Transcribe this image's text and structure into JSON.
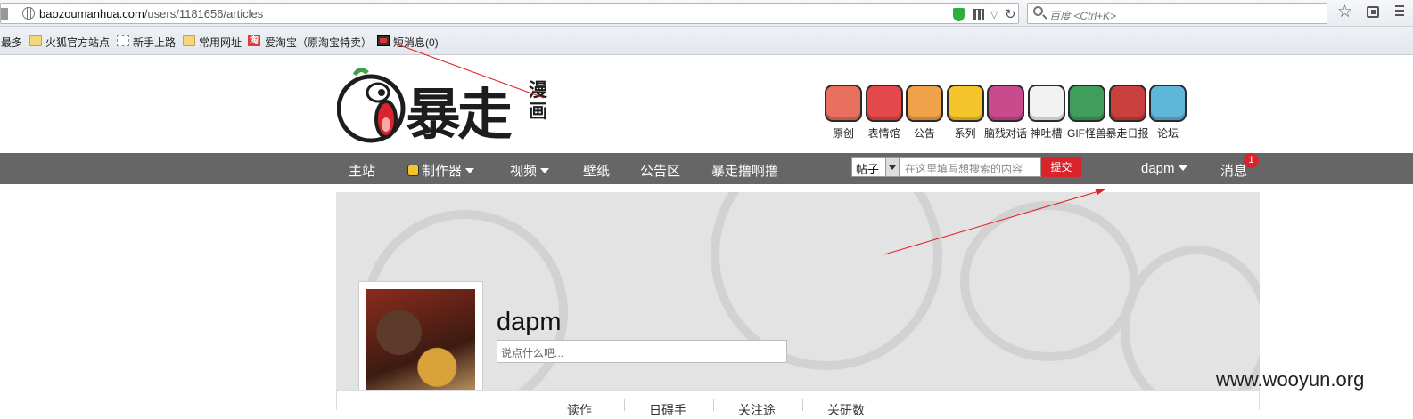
{
  "browser": {
    "url_domain": "baozoumanhua.com",
    "url_path": "/users/1181656/articles",
    "search_placeholder": "百度 <Ctrl+K>",
    "bookmarks": [
      "最多",
      "火狐官方站点",
      "新手上路",
      "常用网址",
      "爱淘宝（原淘宝特卖）",
      "短消息(0)"
    ],
    "taobao_glyph": "淘"
  },
  "site": {
    "logo_text": "暴走",
    "logo_sub": "漫画",
    "channels": [
      {
        "label": "原创",
        "color": "#e8705f",
        "icon": "pencil-icon"
      },
      {
        "label": "表情馆",
        "color": "#e3494a",
        "icon": "face-icon"
      },
      {
        "label": "公告",
        "color": "#f0a24a",
        "icon": "notice-icon"
      },
      {
        "label": "系列",
        "color": "#f4c52b",
        "icon": "tv-icon"
      },
      {
        "label": "脑残对话",
        "color": "#c94b8e",
        "icon": "vs-icon"
      },
      {
        "label": "神吐槽",
        "color": "#f2f2f2",
        "icon": "cat-icon"
      },
      {
        "label": "GIF怪兽",
        "color": "#3f9e5c",
        "icon": "monster-icon"
      },
      {
        "label": "暴走日报",
        "color": "#c9403c",
        "icon": "daily-icon"
      },
      {
        "label": "论坛",
        "color": "#5fb6d6",
        "icon": "forum-icon"
      }
    ]
  },
  "nav": {
    "items": [
      "主站",
      "制作器",
      "视频",
      "壁纸",
      "公告区",
      "暴走撸啊撸"
    ],
    "search_type": "帖子",
    "search_placeholder": "在这里填写想搜索的内容",
    "submit": "提交",
    "user": "dapm",
    "messages": "消息",
    "message_count": "1"
  },
  "profile": {
    "username": "dapm",
    "status_placeholder": "说点什么吧...",
    "tabs": [
      "读作",
      "日碍手",
      "关注途",
      "关研数"
    ]
  },
  "watermark": "www.wooyun.org"
}
